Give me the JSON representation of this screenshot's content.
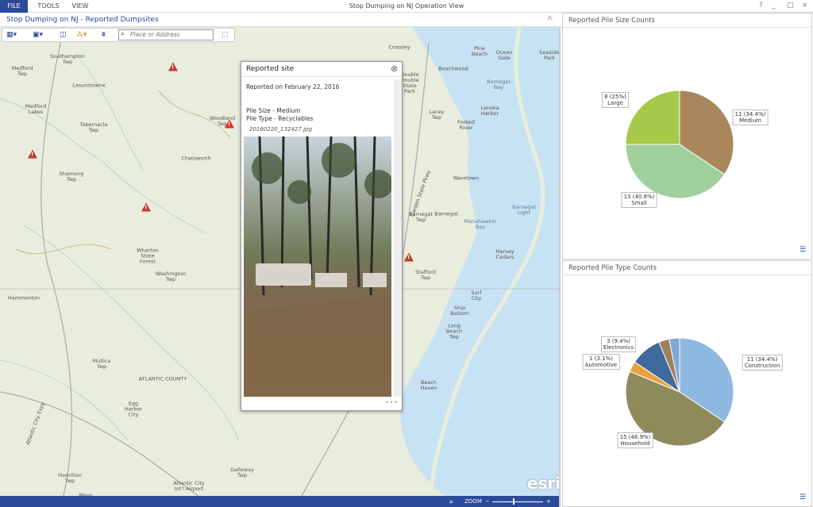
{
  "app": {
    "title": "Stop Dumping on NJ Operation View",
    "menu": [
      "FILE",
      "TOOLS",
      "VIEW"
    ],
    "window_buttons": [
      "?",
      "_",
      "□",
      "×"
    ]
  },
  "map": {
    "title": "Stop Dumping on NJ - Reported Dumpsites",
    "search_placeholder": "Place or Address",
    "labels": [
      "Southampton\nTwp",
      "Medford\nTwp",
      "Lasurotowne",
      "Medford\nLakes",
      "Tabernacle\nTwp",
      "Shamong\nTwp",
      "Chatsworth",
      "Woodland\nTwp",
      "Crossley",
      "Pine\nBeach",
      "Ocean\nGate",
      "Seaside\nPark",
      "Beachwood",
      "Double\nTrouble\nState\nPark",
      "Barnegat\nBay",
      "Lacey\nTwp",
      "Lanoka\nHarbor",
      "Forked\nRiver",
      "Waretown",
      "Barnegat\nTwp",
      "Barnegat",
      "Manahawkin\nBay",
      "Barnegat\nLight",
      "Harvey\nCedars",
      "Stafford\nTwp",
      "Wharton\nState\nForest",
      "Washington\nTwp",
      "Hammonton",
      "Surf\nCity",
      "Ship\nBottom",
      "Long\nBeach\nTwp",
      "Mullica\nTwp",
      "ATLANTIC COUNTY",
      "Beach\nHaven",
      "Egg\nHarbor\nCity",
      "Galloway\nTwp",
      "Hamilton\nTwp",
      "Mays\nLanding",
      "Weymouth",
      "Absecon",
      "Atlantic City\nInt'l Airport",
      "Garden State Pkwy",
      "Atlantic City Expy"
    ],
    "zoom_label": "ZOOM",
    "logo": "POWERED BY esri"
  },
  "popup": {
    "title": "Reported site",
    "reported": "Reported on February 22, 2016",
    "pile_size": "Pile Size - Medium",
    "pile_type": "Pile Type - Recyclables",
    "photo_name": "20160220_132427.jpg",
    "more": "• • •"
  },
  "chart_data": [
    {
      "type": "pie",
      "title": "Reported Pile Size Counts",
      "categories": [
        "Medium",
        "Small",
        "Large"
      ],
      "values": [
        11,
        13,
        8
      ],
      "labels": [
        "11 (34.4%)\nMedium",
        "13 (40.6%)\nSmall",
        "8 (25%)\nLarge"
      ],
      "colors": [
        "#a8875a",
        "#9fd09c",
        "#a6c94a"
      ]
    },
    {
      "type": "pie",
      "title": "Reported Pile Type Counts",
      "categories": [
        "Construction",
        "Household",
        "Automotive",
        "Electronics",
        "",
        ""
      ],
      "values": [
        11,
        15,
        1,
        3,
        1,
        1
      ],
      "labels": [
        "11 (34.4%)\nConstruction",
        "15 (46.9%)\nHousehold",
        "1 (3.1%)\nAutomotive",
        "3 (9.4%)\nElectronics",
        "",
        ""
      ],
      "colors": [
        "#8fb8e0",
        "#8e8a5c",
        "#e8a23c",
        "#3f6b9c",
        "#a08058",
        "#7faad6"
      ]
    }
  ]
}
